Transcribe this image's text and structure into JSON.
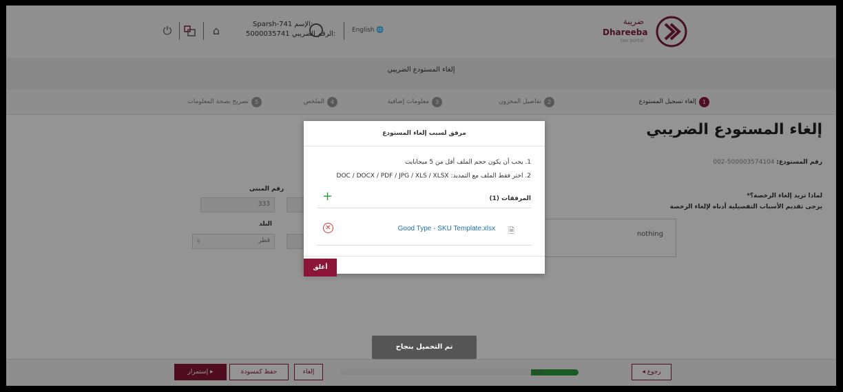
{
  "header": {
    "user_name": "Sparsh-741 الإسم:",
    "tin": "5000035741 الرقم الضريبي:",
    "language": "English",
    "logo_ar": "ضريبة",
    "logo_en": "Dhareeba",
    "logo_sub": "tax portal"
  },
  "page_heading": "إلغاء المستودع الضريبي",
  "steps": [
    {
      "num": "1",
      "label": "إلغاء تسجيل المستودع"
    },
    {
      "num": "2",
      "label": "تفاصيل المخزون"
    },
    {
      "num": "3",
      "label": "معلومات إضافية"
    },
    {
      "num": "4",
      "label": "الملخص"
    },
    {
      "num": "5",
      "label": "تصريح بصحة المعلومات"
    }
  ],
  "form": {
    "big_title": "إلغاء المستودع الضريبي",
    "warehouse_label": "رقم المستودع:",
    "warehouse_value": "500003574104-002",
    "why_label": "لماذا تريد إلغاء الرخصة؟*",
    "details_label": "يرجى تقديم الأسباب التفصيلية أدناه لإلغاء الرخصة",
    "reason_value": "nothing",
    "building_label": "رقم المبنى",
    "building_value": "333",
    "country_label": "البلد",
    "country_value": "قطر"
  },
  "modal": {
    "title": "مرفق لسبب إلغاء المستودع",
    "rule1": "1. يجب أن يكون حجم الملف أقل من 5 ميجابايت",
    "rule2": "2. اختر فقط الملف مع التمديد: DOC / DOCX / PDF / JPG / XLS / XLSX",
    "attachments_label": "المرفقات (1)",
    "file_name": "Good Type - SKU Template.xlsx",
    "close_label": "أغلق"
  },
  "toast": "تم التحميل بنجاح",
  "bottom": {
    "back_label": "◂ رجوع",
    "cancel_label": "إلغاء",
    "save_draft_label": "حفظ كمسودة",
    "continue_label": "إستمرار ▸",
    "progress_text": "20%",
    "progress": 0.2
  },
  "colors": {
    "brand": "#8b1538",
    "success": "#2e9e3e",
    "link": "#1a6fb0"
  },
  "icons": [
    "power-icon",
    "switch-account-icon",
    "home-icon",
    "user-avatar-icon",
    "globe-icon",
    "add-icon",
    "file-icon",
    "remove-icon",
    "chevron-down-icon"
  ]
}
